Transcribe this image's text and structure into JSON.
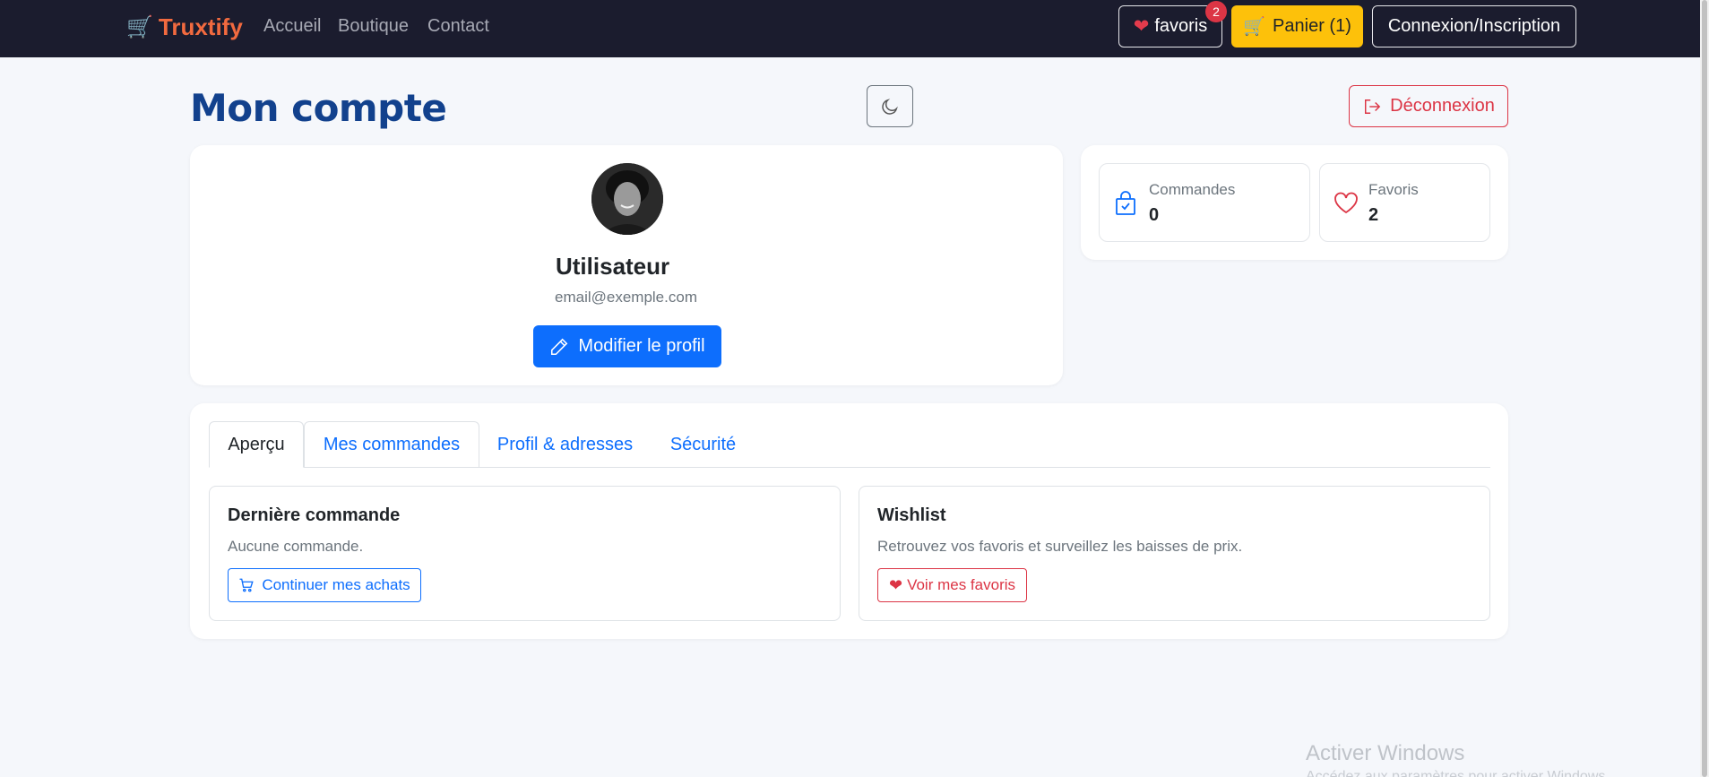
{
  "navbar": {
    "brand": "Truxtify",
    "links": [
      "Accueil",
      "Boutique",
      "Contact"
    ],
    "favorites_label": "favoris",
    "favorites_count": "2",
    "cart_label": "Panier (1)",
    "login_label": "Connexion/Inscription"
  },
  "header": {
    "title": "Mon compte",
    "logout_label": "Déconnexion"
  },
  "profile": {
    "name": "Utilisateur",
    "email": "email@exemple.com",
    "edit_label": "Modifier le profil"
  },
  "stats": {
    "orders_label": "Commandes",
    "orders_value": "0",
    "favorites_label": "Favoris",
    "favorites_value": "2"
  },
  "tabs": [
    {
      "label": "Aperçu",
      "active": true
    },
    {
      "label": "Mes commandes",
      "active": false
    },
    {
      "label": "Profil & adresses",
      "active": false
    },
    {
      "label": "Sécurité",
      "active": false
    }
  ],
  "last_order": {
    "title": "Dernière commande",
    "text": "Aucune commande.",
    "button_label": "Continuer mes achats"
  },
  "wishlist": {
    "title": "Wishlist",
    "text": "Retrouvez vos favoris et surveillez les baisses de prix.",
    "button_label": "Voir mes favoris"
  },
  "watermark": {
    "title": "Activer Windows",
    "subtitle": "Accédez aux paramètres pour activer Windows."
  },
  "colors": {
    "navbar_bg": "#1b1c2e",
    "brand": "#f26a3f",
    "primary": "#0d6efd",
    "danger": "#dc3545",
    "warning": "#fdc10a",
    "title": "#12418d"
  },
  "icons": [
    "cart-icon",
    "heart-icon",
    "moon-icon",
    "logout-icon",
    "pencil-icon",
    "bag-check-icon",
    "heart-outline-icon"
  ]
}
